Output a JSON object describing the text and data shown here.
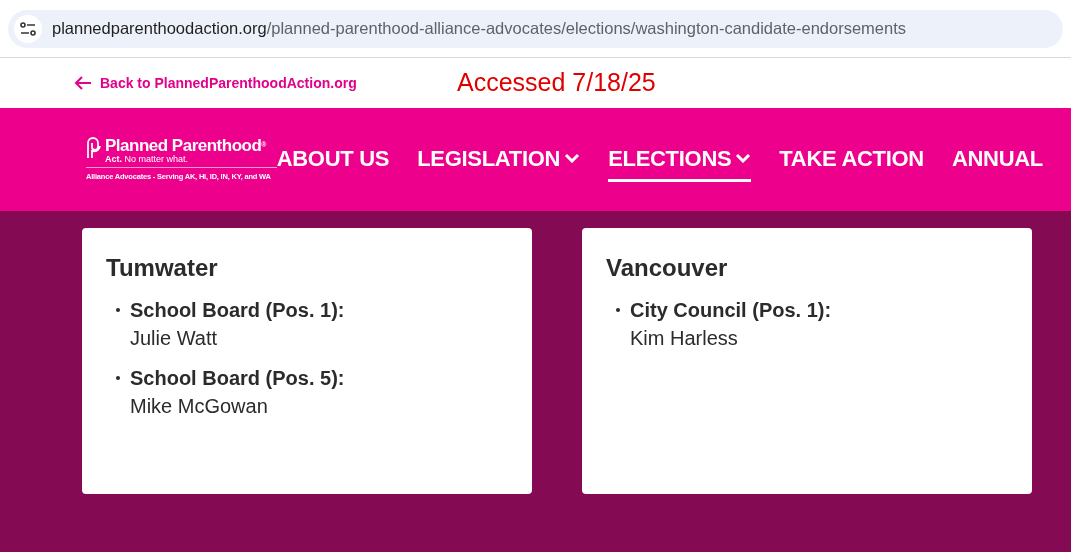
{
  "address_bar": {
    "domain": "plannedparenthoodaction.org",
    "path": "/planned-parenthood-alliance-advocates/elections/washington-candidate-endorsements"
  },
  "back_link": "Back to PlannedParenthoodAction.org",
  "annotation": "Accessed 7/18/25",
  "logo": {
    "name": "Planned Parenthood",
    "mark": "®",
    "tagline_bold": "Act.",
    "tagline": "No matter what.",
    "subtitle": "Alliance Advocates - Serving AK, HI, ID, IN, KY, and WA"
  },
  "nav": [
    {
      "label": "ABOUT US",
      "has_menu": false,
      "selected": false
    },
    {
      "label": "LEGISLATION",
      "has_menu": true,
      "selected": false
    },
    {
      "label": "ELECTIONS",
      "has_menu": true,
      "selected": true
    },
    {
      "label": "TAKE ACTION",
      "has_menu": false,
      "selected": false
    },
    {
      "label": "ANNUAL",
      "has_menu": false,
      "selected": false
    }
  ],
  "cards": [
    {
      "city": "Tumwater",
      "races": [
        {
          "office": "School Board (Pos. 1):",
          "candidate": "Julie Watt"
        },
        {
          "office": "School Board (Pos. 5):",
          "candidate": "Mike McGowan"
        }
      ]
    },
    {
      "city": "Vancouver",
      "races": [
        {
          "office": "City Council (Pos. 1):",
          "candidate": "Kim Harless"
        }
      ]
    }
  ]
}
